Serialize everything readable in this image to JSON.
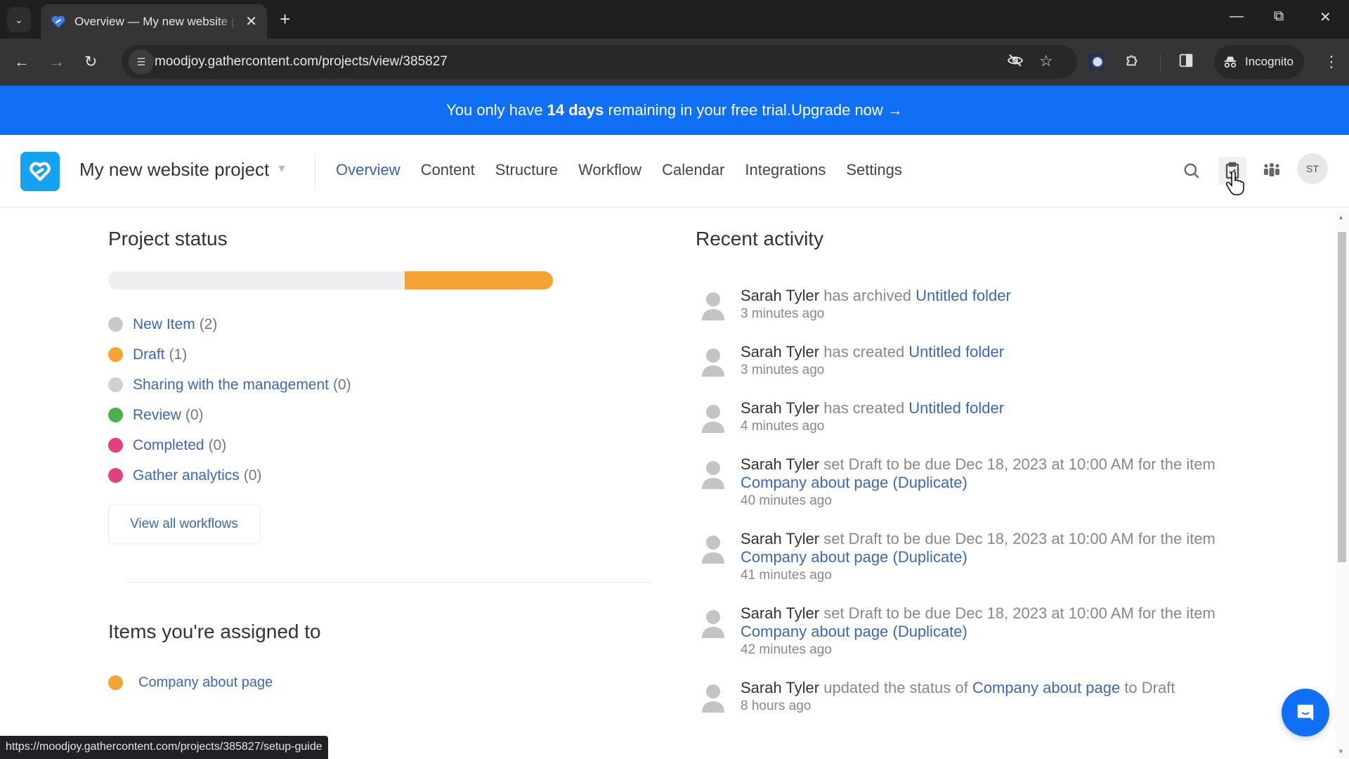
{
  "browser": {
    "tab_title": "Overview — My new website project",
    "url": "moodjoy.gathercontent.com/projects/view/385827",
    "profile_label": "Incognito",
    "status_url": "https://moodjoy.gathercontent.com/projects/385827/setup-guide"
  },
  "banner": {
    "prefix": "You only have ",
    "days": "14 days",
    "suffix": " remaining in your free trial. ",
    "cta": "Upgrade now →"
  },
  "header": {
    "project_name": "My new website project",
    "nav": [
      {
        "label": "Overview",
        "active": true
      },
      {
        "label": "Content"
      },
      {
        "label": "Structure"
      },
      {
        "label": "Workflow"
      },
      {
        "label": "Calendar"
      },
      {
        "label": "Integrations"
      },
      {
        "label": "Settings"
      }
    ],
    "user_initials": "ST"
  },
  "project_status": {
    "title": "Project status",
    "progress": [
      {
        "status": "New Item",
        "fraction": 0.667,
        "color": "#eeeff1"
      },
      {
        "status": "Draft",
        "fraction": 0.333,
        "color": "#f5a431"
      }
    ],
    "statuses": [
      {
        "label": "New Item",
        "count": "(2)",
        "color": "#c8c8c8"
      },
      {
        "label": "Draft",
        "count": "(1)",
        "color": "#f5a431"
      },
      {
        "label": "Sharing with the management",
        "count": "(0)",
        "color": "#d0d0d2"
      },
      {
        "label": "Review",
        "count": "(0)",
        "color": "#4caf50"
      },
      {
        "label": "Completed",
        "count": "(0)",
        "color": "#e2407f"
      },
      {
        "label": "Gather analytics",
        "count": "(0)",
        "color": "#e2407f"
      }
    ],
    "view_all_label": "View all workflows"
  },
  "assigned": {
    "title": "Items you're assigned to",
    "items": [
      {
        "label": "Company about page",
        "color": "#f5a431"
      }
    ]
  },
  "activity": {
    "title": "Recent activity",
    "items": [
      {
        "actor": "Sarah Tyler",
        "action": " has archived ",
        "link": "Untitled folder",
        "after": "",
        "time": "3 minutes ago"
      },
      {
        "actor": "Sarah Tyler",
        "action": " has created ",
        "link": "Untitled folder",
        "after": "",
        "time": "3 minutes ago"
      },
      {
        "actor": "Sarah Tyler",
        "action": " has created ",
        "link": "Untitled folder",
        "after": "",
        "time": "4 minutes ago"
      },
      {
        "actor": "Sarah Tyler",
        "action": " set Draft to be due Dec 18, 2023 at 10:00 AM for the item ",
        "link": "Company about page (Duplicate)",
        "after": "",
        "time": "40 minutes ago"
      },
      {
        "actor": "Sarah Tyler",
        "action": " set Draft to be due Dec 18, 2023 at 10:00 AM for the item ",
        "link": "Company about page (Duplicate)",
        "after": "",
        "time": "41 minutes ago"
      },
      {
        "actor": "Sarah Tyler",
        "action": " set Draft to be due Dec 18, 2023 at 10:00 AM for the item ",
        "link": "Company about page (Duplicate)",
        "after": "",
        "time": "42 minutes ago"
      },
      {
        "actor": "Sarah Tyler",
        "action": " updated the status of ",
        "link": "Company about page",
        "after": " to Draft",
        "time": "8 hours ago"
      }
    ]
  }
}
